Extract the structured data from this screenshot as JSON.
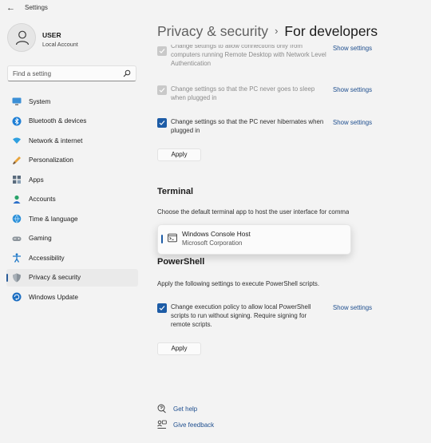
{
  "window": {
    "title": "Settings"
  },
  "user": {
    "name": "USER",
    "account": "Local Account"
  },
  "search": {
    "placeholder": "Find a setting"
  },
  "sidebar": {
    "items": [
      {
        "label": "System",
        "icon": "monitor-icon"
      },
      {
        "label": "Bluetooth & devices",
        "icon": "bluetooth-icon"
      },
      {
        "label": "Network & internet",
        "icon": "wifi-icon"
      },
      {
        "label": "Personalization",
        "icon": "brush-icon"
      },
      {
        "label": "Apps",
        "icon": "apps-icon"
      },
      {
        "label": "Accounts",
        "icon": "accounts-icon"
      },
      {
        "label": "Time & language",
        "icon": "globe-clock-icon"
      },
      {
        "label": "Gaming",
        "icon": "gamepad-icon"
      },
      {
        "label": "Accessibility",
        "icon": "accessibility-icon"
      },
      {
        "label": "Privacy & security",
        "icon": "shield-icon",
        "active": true
      },
      {
        "label": "Windows Update",
        "icon": "update-icon"
      }
    ]
  },
  "breadcrumb": {
    "parent": "Privacy & security",
    "separator": "›",
    "current": "For developers"
  },
  "remote_desktop": {
    "settings": [
      {
        "text": "Change settings to allow connections only from computers running Remote Desktop with Network Level Authentication",
        "checked": true,
        "enabled": false,
        "link": "Show settings"
      },
      {
        "text": "Change settings so that the PC never goes to sleep when plugged in",
        "checked": true,
        "enabled": false,
        "link": "Show settings"
      },
      {
        "text": "Change settings so that the PC never hibernates when plugged in",
        "checked": true,
        "enabled": true,
        "link": "Show settings"
      }
    ],
    "apply_label": "Apply"
  },
  "terminal": {
    "title": "Terminal",
    "description": "Choose the default terminal app to host the user interface for command-line applications",
    "dropdown_option": {
      "title": "Windows Console Host",
      "publisher": "Microsoft Corporation"
    }
  },
  "powershell": {
    "title": "PowerShell",
    "description": "Apply the following settings to execute PowerShell scripts.",
    "setting": {
      "text": "Change execution policy to allow local PowerShell scripts to run without signing. Require signing for remote scripts.",
      "checked": true,
      "link": "Show settings"
    },
    "apply_label": "Apply"
  },
  "footer": {
    "help_label": "Get help",
    "feedback_label": "Give feedback"
  },
  "colors": {
    "accent": "#1d5ca6",
    "link": "#1f4f8f",
    "background": "#f3f3f3"
  }
}
